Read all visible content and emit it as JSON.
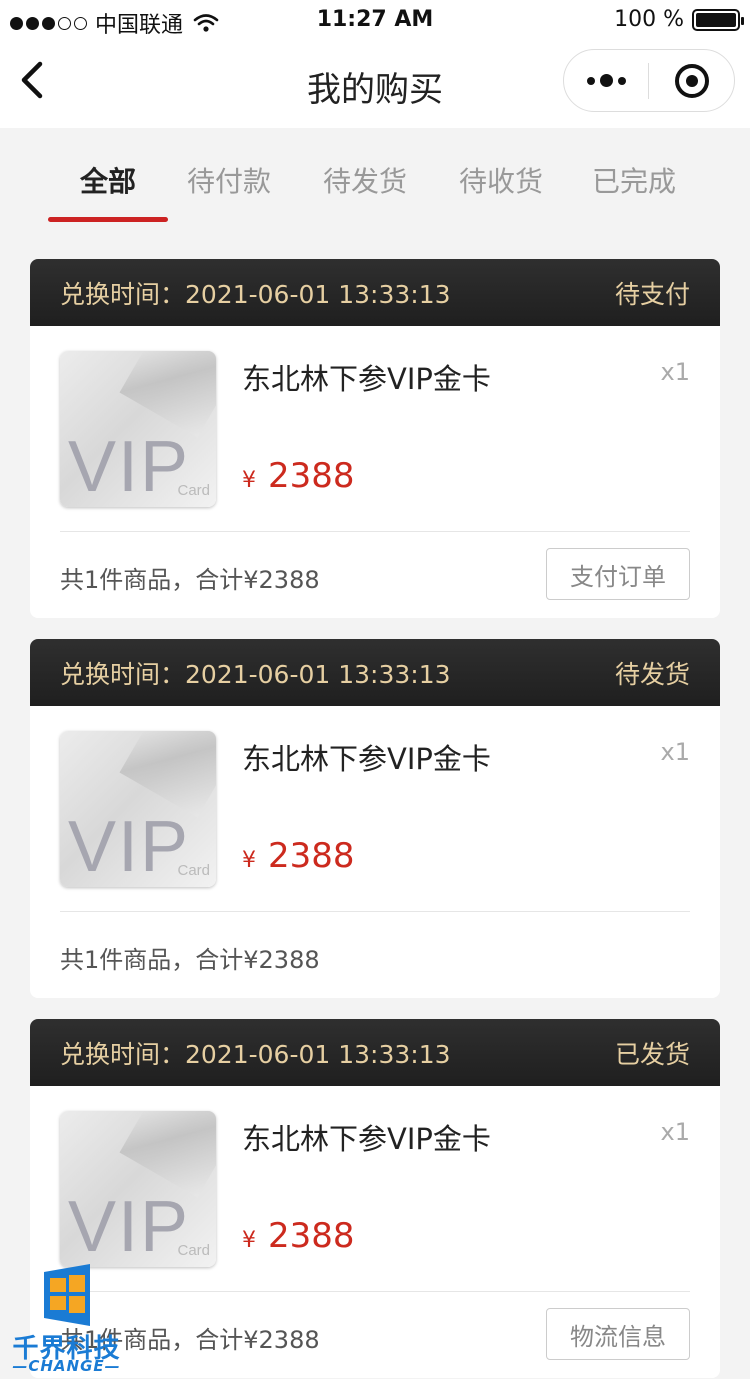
{
  "status_bar": {
    "carrier": "中国联通",
    "time": "11:27 AM",
    "battery": "100 %",
    "battery_level": 1.0
  },
  "nav": {
    "title": "我的购买"
  },
  "tabs": [
    {
      "label": "全部",
      "active": true
    },
    {
      "label": "待付款",
      "active": false
    },
    {
      "label": "待发货",
      "active": false
    },
    {
      "label": "待收货",
      "active": false
    },
    {
      "label": "已完成",
      "active": false
    }
  ],
  "orders": [
    {
      "time_label": "兑换时间：2021-06-01 13:33:13",
      "status": "待支付",
      "product_name": "东北林下参VIP金卡",
      "quantity": "x1",
      "currency": "¥",
      "price": "2388",
      "summary": "共1件商品，合计¥2388",
      "action": "支付订单"
    },
    {
      "time_label": "兑换时间：2021-06-01 13:33:13",
      "status": "待发货",
      "product_name": "东北林下参VIP金卡",
      "quantity": "x1",
      "currency": "¥",
      "price": "2388",
      "summary": "共1件商品，合计¥2388",
      "action": ""
    },
    {
      "time_label": "兑换时间：2021-06-01 13:33:13",
      "status": "已发货",
      "product_name": "东北林下参VIP金卡",
      "quantity": "x1",
      "currency": "¥",
      "price": "2388",
      "summary": "共1件商品，合计¥2388",
      "action": "物流信息"
    }
  ],
  "product_image": {
    "vip_text": "VIP",
    "card_text": "Card"
  },
  "watermark": {
    "title": "千界科技",
    "subtitle": "—CHANGE—"
  },
  "colors": {
    "accent_red": "#cc2222",
    "header_gold": "#e6cfa2",
    "watermark_blue": "#1a7bd4"
  }
}
